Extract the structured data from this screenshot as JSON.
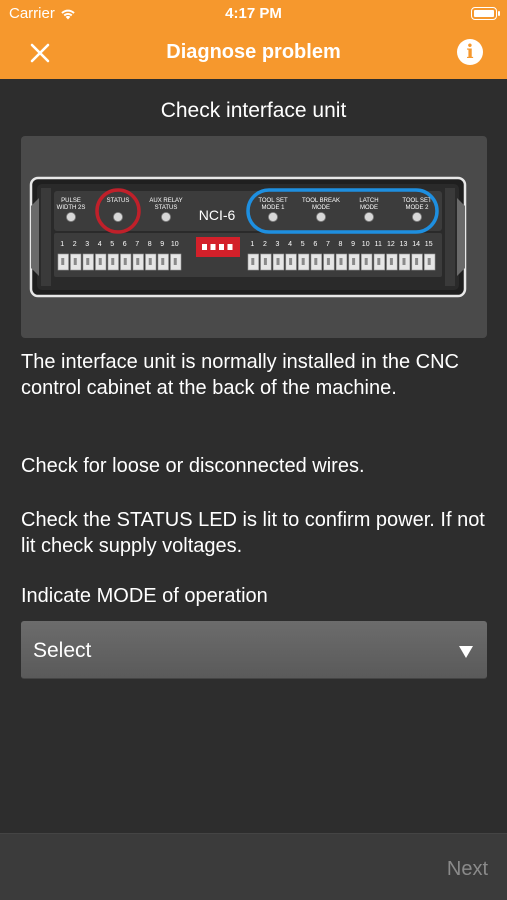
{
  "status_bar": {
    "carrier": "Carrier",
    "time": "4:17 PM"
  },
  "nav": {
    "title": "Diagnose problem",
    "close_icon": "close-icon",
    "info_icon": "info-icon"
  },
  "heading": "Check interface unit",
  "figure": {
    "unit_name": "NCI-6",
    "leds_left": [
      {
        "line1": "PULSE",
        "line2": "WIDTH 2S"
      },
      {
        "line1": "STATUS",
        "line2": ""
      },
      {
        "line1": "AUX RELAY",
        "line2": "STATUS"
      }
    ],
    "leds_right": [
      {
        "line1": "TOOL SET",
        "line2": "MODE 1"
      },
      {
        "line1": "TOOL BREAK",
        "line2": "MODE"
      },
      {
        "line1": "LATCH",
        "line2": "MODE"
      },
      {
        "line1": "TOOL SET",
        "line2": "MODE 2"
      }
    ],
    "terminals_left": [
      "1",
      "2",
      "3",
      "4",
      "5",
      "6",
      "7",
      "8",
      "9",
      "10"
    ],
    "terminals_right": [
      "1",
      "2",
      "3",
      "4",
      "5",
      "6",
      "7",
      "8",
      "9",
      "10",
      "11",
      "12",
      "13",
      "14",
      "15"
    ],
    "status_highlight_color": "#c0202a",
    "mode_highlight_color": "#1e8fe0"
  },
  "paragraphs": {
    "p1": "The interface unit is normally installed in the CNC control cabinet at the back of the machine.",
    "p2": "Check for loose or disconnected wires.",
    "p3": "Check the STATUS LED is lit to confirm power. If not lit check supply voltages."
  },
  "mode": {
    "label": "Indicate MODE of operation",
    "selected": "Select"
  },
  "footer": {
    "next_label": "Next"
  },
  "colors": {
    "accent": "#f6982d",
    "background": "#2d2d2d"
  }
}
